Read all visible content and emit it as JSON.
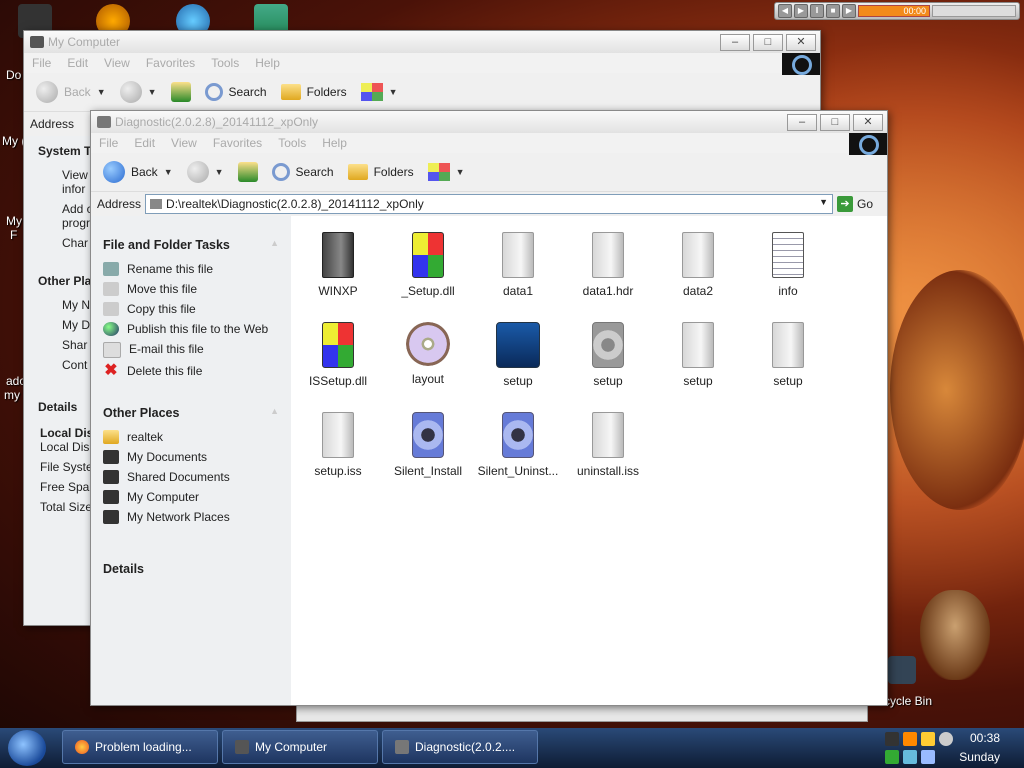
{
  "colors": {
    "accent": "#2a6ad0",
    "taskbar": "#1e3560",
    "desktop": "#a83a14"
  },
  "desktop": {
    "labels": [
      "Do",
      "My (",
      "My",
      "F",
      "ado",
      "my",
      "cycle Bin"
    ]
  },
  "media_player": {
    "time": "00:00"
  },
  "back_window": {
    "title": "My Computer",
    "menu": [
      "File",
      "Edit",
      "View",
      "Favorites",
      "Tools",
      "Help"
    ],
    "toolbar": {
      "back": "Back",
      "search": "Search",
      "folders": "Folders"
    },
    "address_label": "Address",
    "side_text": [
      "System T",
      "View",
      "infor",
      "Add c",
      "progr",
      "Char",
      "Other Pla",
      "My N",
      "My D",
      "Shar",
      "Cont",
      "Details",
      "Local Dis",
      "Local Dis",
      "File Syste",
      "Free Spa",
      "Total Size"
    ]
  },
  "window": {
    "title": "Diagnostic(2.0.2.8)_20141112_xpOnly",
    "menu": [
      "File",
      "Edit",
      "View",
      "Favorites",
      "Tools",
      "Help"
    ],
    "toolbar": {
      "back": "Back",
      "search": "Search",
      "folders": "Folders"
    },
    "address": {
      "label": "Address",
      "value": "D:\\realtek\\Diagnostic(2.0.2.8)_20141112_xpOnly",
      "go": "Go"
    },
    "tasks": {
      "title": "File and Folder Tasks",
      "items": [
        "Rename this file",
        "Move this file",
        "Copy this file",
        "Publish this file to the Web",
        "E-mail this file",
        "Delete this file"
      ]
    },
    "other_places": {
      "title": "Other Places",
      "items": [
        "realtek",
        "My Documents",
        "Shared Documents",
        "My Computer",
        "My Network Places"
      ]
    },
    "details": {
      "title": "Details"
    },
    "files": [
      {
        "name": "WINXP",
        "icon": "file-dark-icon"
      },
      {
        "name": "_Setup.dll",
        "icon": "dll-icon"
      },
      {
        "name": "data1",
        "icon": "file-icon"
      },
      {
        "name": "data1.hdr",
        "icon": "file-icon"
      },
      {
        "name": "data2",
        "icon": "file-icon"
      },
      {
        "name": "info",
        "icon": "info-file-icon"
      },
      {
        "name": "ISSetup.dll",
        "icon": "dll-icon"
      },
      {
        "name": "layout",
        "icon": "disc-icon"
      },
      {
        "name": "setup",
        "icon": "setup-app-icon"
      },
      {
        "name": "setup",
        "icon": "gear-icon"
      },
      {
        "name": "setup",
        "icon": "file-icon"
      },
      {
        "name": "setup",
        "icon": "file-icon"
      },
      {
        "name": "setup.iss",
        "icon": "file-icon"
      },
      {
        "name": "Silent_Install",
        "icon": "gear-blue-icon"
      },
      {
        "name": "Silent_Uninst...",
        "icon": "gear-blue-icon"
      },
      {
        "name": "uninstall.iss",
        "icon": "file-icon"
      }
    ]
  },
  "taskbar": {
    "buttons": [
      "Problem loading...",
      "My Computer",
      "Diagnostic(2.0.2...."
    ],
    "clock_time": "00:38",
    "clock_day": "Sunday"
  }
}
